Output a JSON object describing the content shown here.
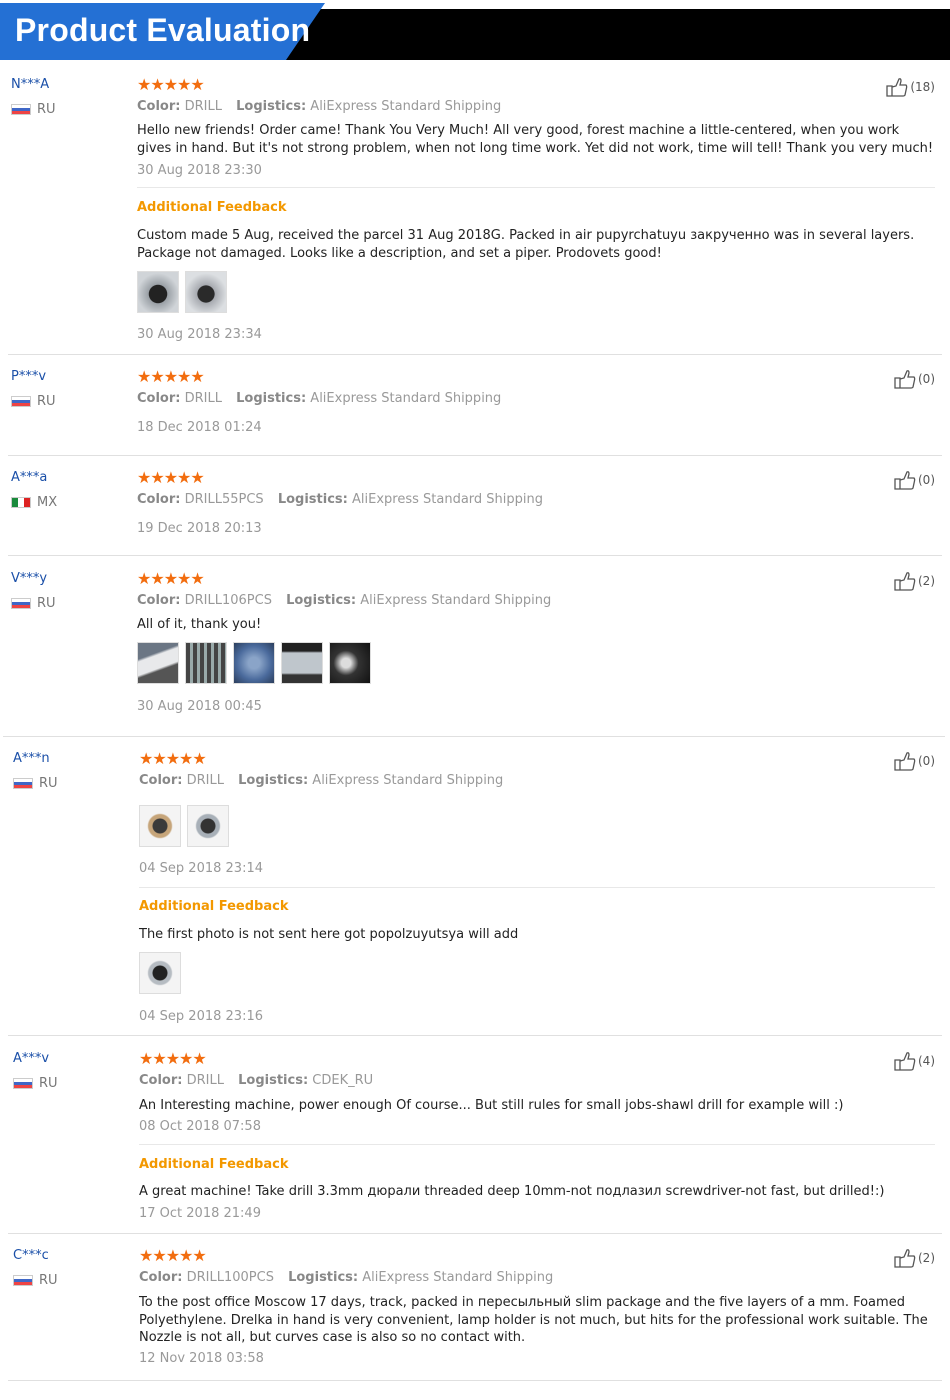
{
  "header": {
    "title": "Product Evaluation"
  },
  "labels": {
    "color": "Color:",
    "logistics": "Logistics:",
    "additional": "Additional Feedback"
  },
  "stars": "★★★★★",
  "reviews": [
    {
      "user": "N***A",
      "country": "RU",
      "likes": "(18)",
      "color": "DRILL",
      "logistics": "AliExpress Standard Shipping",
      "text": "Hello new friends! Order came! Thank You Very Much! All very good, forest machine a little-centered, when you work gives in hand. But it's not strong problem, when not long time work. Yet did not work, time will tell! Thank you very much!",
      "date": "30 Aug 2018 23:30",
      "additional_text": "Custom made 5 Aug, received the parcel 31 Aug 2018G. Packed in air pupyrchatuyu закрученно was in several layers. Package not damaged. Looks like a description, and set a piper. Prodovets good!",
      "additional_date": "30 Aug 2018 23:34"
    },
    {
      "user": "P***v",
      "country": "RU",
      "likes": "(0)",
      "color": "DRILL",
      "logistics": "AliExpress Standard Shipping",
      "date": "18 Dec 2018 01:24"
    },
    {
      "user": "A***a",
      "country": "MX",
      "likes": "(0)",
      "color": "DRILL55PCS",
      "logistics": "AliExpress Standard Shipping",
      "date": "19 Dec 2018 20:13"
    },
    {
      "user": "V***y",
      "country": "RU",
      "likes": "(2)",
      "color": "DRILL106PCS",
      "logistics": "AliExpress Standard Shipping",
      "text": "All of it, thank you!",
      "date": "30 Aug 2018 00:45"
    },
    {
      "user": "A***n",
      "country": "RU",
      "likes": "(0)",
      "color": "DRILL",
      "logistics": "AliExpress Standard Shipping",
      "date": "04 Sep 2018 23:14",
      "additional_text": "The first photo is not sent here got popolzuyutsya will add",
      "additional_date": "04 Sep 2018 23:16"
    },
    {
      "user": "A***v",
      "country": "RU",
      "likes": "(4)",
      "color": "DRILL",
      "logistics": "CDEK_RU",
      "text": "An Interesting machine, power enough Of course... But still rules for small jobs-shawl drill for example will :)",
      "date": "08 Oct 2018 07:58",
      "additional_text": "A great machine! Take drill 3.3mm дюрали threaded deep 10mm-not подлазил screwdriver-not fast, but drilled!:)",
      "additional_date": "17 Oct 2018 21:49"
    },
    {
      "user": "C***c",
      "country": "RU",
      "likes": "(2)",
      "color": "DRILL100PCS",
      "logistics": "AliExpress Standard Shipping",
      "text": "To the post office Moscow 17 days, track, packed in пересыльный slim package and the five layers of a mm. Foamed Polyethylene. Drelka in hand is very convenient, lamp holder is not much, but hits for the professional work suitable. The Nozzle is not all, but curves case is also so no contact with.",
      "date": "12 Nov 2018 03:58"
    }
  ]
}
